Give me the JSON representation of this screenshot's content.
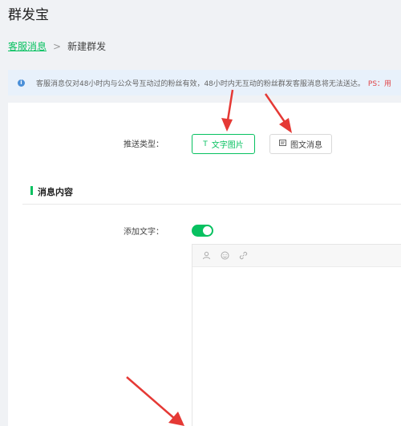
{
  "app": {
    "title": "群发宝"
  },
  "breadcrumb": {
    "parent": "客服消息",
    "separator": ">",
    "current": "新建群发"
  },
  "notice": {
    "icon": "info-icon",
    "text": "客服消息仅对48小时内与公众号互动过的粉丝有效，48小时内无互动的粉丝群发客服消息将无法送达。",
    "ps": "PS：用"
  },
  "form": {
    "push_type_label": "推送类型：",
    "push_types": [
      {
        "label": "文字图片",
        "icon": "text-icon",
        "selected": true
      },
      {
        "label": "图文消息",
        "icon": "image-message-icon",
        "selected": false
      }
    ],
    "section_title": "消息内容",
    "add_text_label": "添加文字：",
    "add_text_enabled": true,
    "editor_tools": [
      "user-icon",
      "emoji-icon",
      "link-icon"
    ]
  },
  "colors": {
    "accent": "#07c160",
    "annotation": "#e53935",
    "notice_bg": "#e8f1fb",
    "ps_text": "#e0464a"
  }
}
